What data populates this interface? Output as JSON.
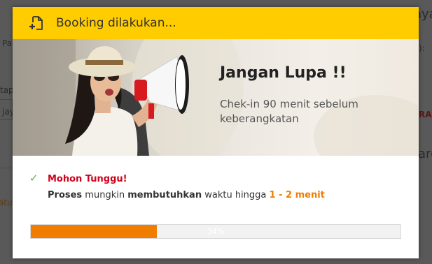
{
  "background_page": {
    "fragments": [
      "ayar",
      "Pa",
      "):",
      "tap",
      "RAS",
      "jay",
      "arg",
      "atu"
    ]
  },
  "modal": {
    "title": "Booking dilakukan...",
    "header_icon": "file-add-icon",
    "header_color": "#ffcc00"
  },
  "banner": {
    "title": "Jangan Lupa !!",
    "subtitle": "Chek-in 90 menit sebelum keberangkatan"
  },
  "status": {
    "icon": "check-icon",
    "title": "Mohon Tunggu!",
    "message": {
      "part1": "Proses",
      "part2": " mungkin ",
      "part3": "membutuhkan",
      "part4": " waktu hingga ",
      "part5": "1 - 2 menit"
    }
  },
  "progress": {
    "percent": 34,
    "label": "34%",
    "fill_color": "#f07d00"
  }
}
